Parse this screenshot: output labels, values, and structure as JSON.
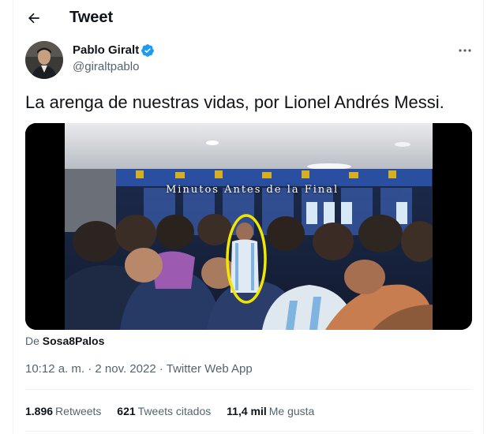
{
  "header": {
    "title": "Tweet"
  },
  "author": {
    "name": "Pablo Giralt",
    "handle": "@giraltpablo"
  },
  "tweet": {
    "text": "La arenga de nuestras vidas, por Lionel Andrés Messi."
  },
  "media": {
    "overlay_title": "Minutos Antes de la Final"
  },
  "source": {
    "prefix": "De",
    "name": "Sosa8Palos"
  },
  "meta": {
    "time": "10:12 a. m.",
    "sep1": "·",
    "date": "2 nov. 2022",
    "sep2": "·",
    "client": "Twitter Web App"
  },
  "stats": [
    {
      "count": "1.896",
      "label": "Retweets"
    },
    {
      "count": "621",
      "label": "Tweets citados"
    },
    {
      "count": "11,4 mil",
      "label": "Me gusta"
    }
  ],
  "icons": {
    "back": "arrow-left-icon",
    "verified": "verified-badge-icon",
    "more": "more-horizontal-icon"
  },
  "colors": {
    "accent": "#1d9bf0",
    "secondary_text": "#536471",
    "highlight_circle": "#f2e600"
  }
}
